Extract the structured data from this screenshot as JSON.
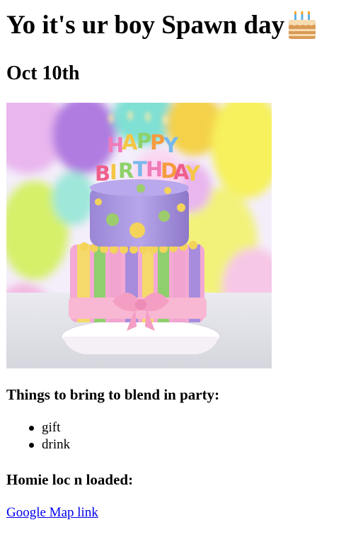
{
  "header": {
    "title": "Yo it's ur boy Spawn day",
    "title_icon": "birthday-cake-icon"
  },
  "date_heading": "Oct 10th",
  "hero_image": {
    "subject": "birthday cake with candles and balloons",
    "candle_letters": "HAPPY BIRTHDAY"
  },
  "bring_section": {
    "heading": "Things to bring to blend in party:",
    "items": [
      "gift",
      "drink"
    ]
  },
  "location_section": {
    "heading": "Homie loc n loaded:",
    "link_text": "Google Map link"
  }
}
